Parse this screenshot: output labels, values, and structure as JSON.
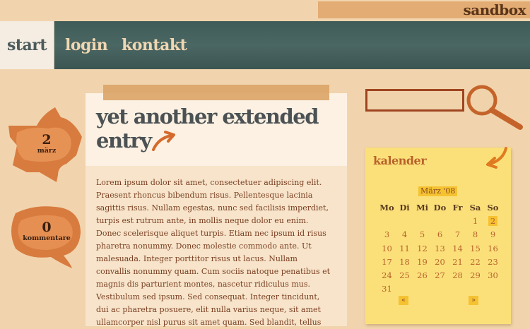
{
  "header": {
    "brand": "sandbox"
  },
  "nav": {
    "items": [
      {
        "label": "start",
        "active": true
      },
      {
        "label": "login",
        "active": false
      },
      {
        "label": "kontakt",
        "active": false
      }
    ]
  },
  "post": {
    "date_day": "2",
    "date_month": "märz",
    "comments_count": "0",
    "comments_label": "kommentare",
    "title": "yet another extended entry",
    "body": "Lorem ipsum dolor sit amet, consectetuer adipiscing elit. Praesent rhoncus bibendum risus. Pellentesque lacinia sagittis risus. Nullam egestas, nunc sed facilisis imperdiet, turpis est rutrum ante, in mollis neque dolor eu enim. Donec scelerisque aliquet turpis. Etiam nec ipsum id risus pharetra nonummy. Donec molestie commodo ante. Ut malesuada. Integer porttitor risus ut lacus. Nullam convallis nonummy quam. Cum sociis natoque penatibus et magnis dis parturient montes, nascetur ridiculus mus. Vestibulum sed ipsum. Sed consequat. Integer tincidunt, dui ac pharetra posuere, elit nulla varius neque, sit amet ullamcorper nisl purus sit amet quam. Sed blandit, tellus"
  },
  "search": {
    "icon": "magnifier-icon"
  },
  "calendar": {
    "title": "kalender",
    "month": "März '08",
    "weekdays": [
      "Mo",
      "Di",
      "Mi",
      "Do",
      "Fr",
      "Sa",
      "So"
    ],
    "rows": [
      [
        "",
        "",
        "",
        "",
        "",
        "1",
        "2"
      ],
      [
        "3",
        "4",
        "5",
        "6",
        "7",
        "8",
        "9"
      ],
      [
        "10",
        "11",
        "12",
        "13",
        "14",
        "15",
        "16"
      ],
      [
        "17",
        "18",
        "19",
        "20",
        "21",
        "22",
        "23"
      ],
      [
        "24",
        "25",
        "26",
        "27",
        "28",
        "29",
        "30"
      ],
      [
        "31",
        "",
        "",
        "",
        "",
        "",
        ""
      ]
    ],
    "today": "2",
    "prev_label": "«",
    "next_label": "»"
  },
  "colors": {
    "background": "#f1d4ad",
    "nav_bar": "#445f5b",
    "accent_orange": "#d46b2c",
    "calendar_bg": "#fbe07a"
  }
}
